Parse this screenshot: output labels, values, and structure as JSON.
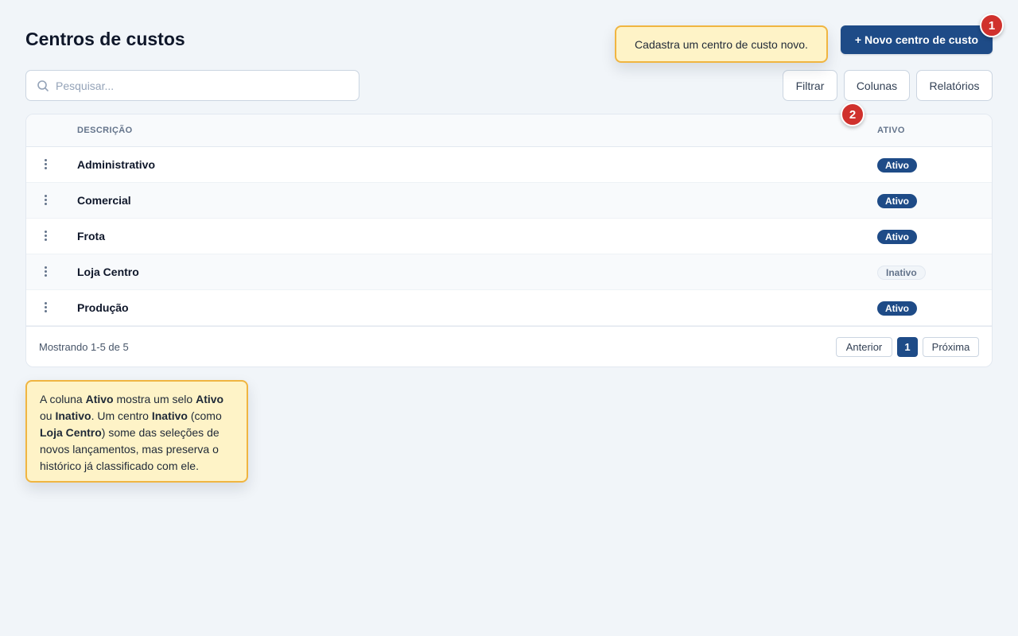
{
  "page": {
    "title": "Centros de custos"
  },
  "toolbar": {
    "new_button_label": "+ Novo centro de custo",
    "search_placeholder": "Pesquisar...",
    "filter_label": "Filtrar",
    "columns_label": "Colunas",
    "reports_label": "Relatórios"
  },
  "markers": [
    "1",
    "2"
  ],
  "tooltips": {
    "new_button": "Cadastra um centro de custo novo.",
    "active_column": {
      "p1": "A coluna ",
      "b1": "Ativo",
      "p2": " mostra um selo ",
      "b2": "Ativo",
      "p3": " ou ",
      "b3": "Inativo",
      "p4": ". Um centro ",
      "b4": "Inativo",
      "p5": " (como ",
      "b5": "Loja Centro",
      "p6": ") some das seleções de novos lançamentos, mas preserva o histórico já classificado com ele."
    }
  },
  "table": {
    "columns": [
      "DESCRIÇÃO",
      "ATIVO"
    ],
    "rows": [
      {
        "description": "Administrativo",
        "status": "Ativo"
      },
      {
        "description": "Comercial",
        "status": "Ativo"
      },
      {
        "description": "Frota",
        "status": "Ativo"
      },
      {
        "description": "Loja Centro",
        "status": "Inativo"
      },
      {
        "description": "Produção",
        "status": "Ativo"
      }
    ]
  },
  "pagination": {
    "summary": "Mostrando 1-5 de 5",
    "prev_label": "Anterior",
    "current_page": "1",
    "next_label": "Próxima"
  },
  "colors": {
    "primary": "#1e4b87",
    "marker": "#d0312d",
    "tooltip_bg": "#fef3c7",
    "tooltip_border": "#f0b541",
    "background": "#f1f5f9"
  }
}
